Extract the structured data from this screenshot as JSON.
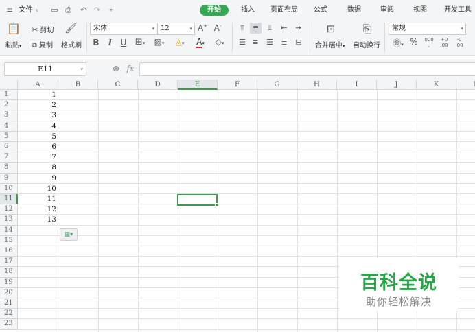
{
  "menu": {
    "menu_icon": "hamburger-icon",
    "file_label": "文件",
    "tabs": [
      {
        "label": "开始",
        "active": true
      },
      {
        "label": "插入"
      },
      {
        "label": "页面布局"
      },
      {
        "label": "公式"
      },
      {
        "label": "数据"
      },
      {
        "label": "审阅"
      },
      {
        "label": "视图"
      },
      {
        "label": "开发工具"
      }
    ]
  },
  "ribbon": {
    "cut_label": "剪切",
    "paste_label": "粘贴",
    "copy_label": "复制",
    "format_painter_label": "格式刷",
    "font_name": "宋体",
    "font_size": "12",
    "merge_center_label": "合并居中",
    "wrap_text_label": "自动换行",
    "number_format": "常规",
    "percent_symbol": "%"
  },
  "formula_bar": {
    "name_box": "E11",
    "fx_label": "fx"
  },
  "sheet": {
    "columns": [
      "A",
      "B",
      "C",
      "D",
      "E",
      "F",
      "G",
      "H",
      "I",
      "J",
      "K",
      "L"
    ],
    "rows": [
      "1",
      "2",
      "3",
      "4",
      "5",
      "6",
      "7",
      "8",
      "9",
      "10",
      "11",
      "12",
      "13",
      "14",
      "15",
      "16",
      "17",
      "18",
      "19",
      "20",
      "21",
      "22",
      "23"
    ],
    "column_a_values": [
      "1",
      "2",
      "3",
      "4",
      "5",
      "6",
      "7",
      "8",
      "9",
      "10",
      "11",
      "12",
      "13"
    ],
    "selected_column": "E",
    "selected_row": "11"
  },
  "watermark": {
    "title": "百科全说",
    "subtitle": "助你轻松解决",
    "color": "#26a847"
  },
  "colors": {
    "accent_green": "#34a853",
    "selection_border": "#3c9a4a"
  }
}
